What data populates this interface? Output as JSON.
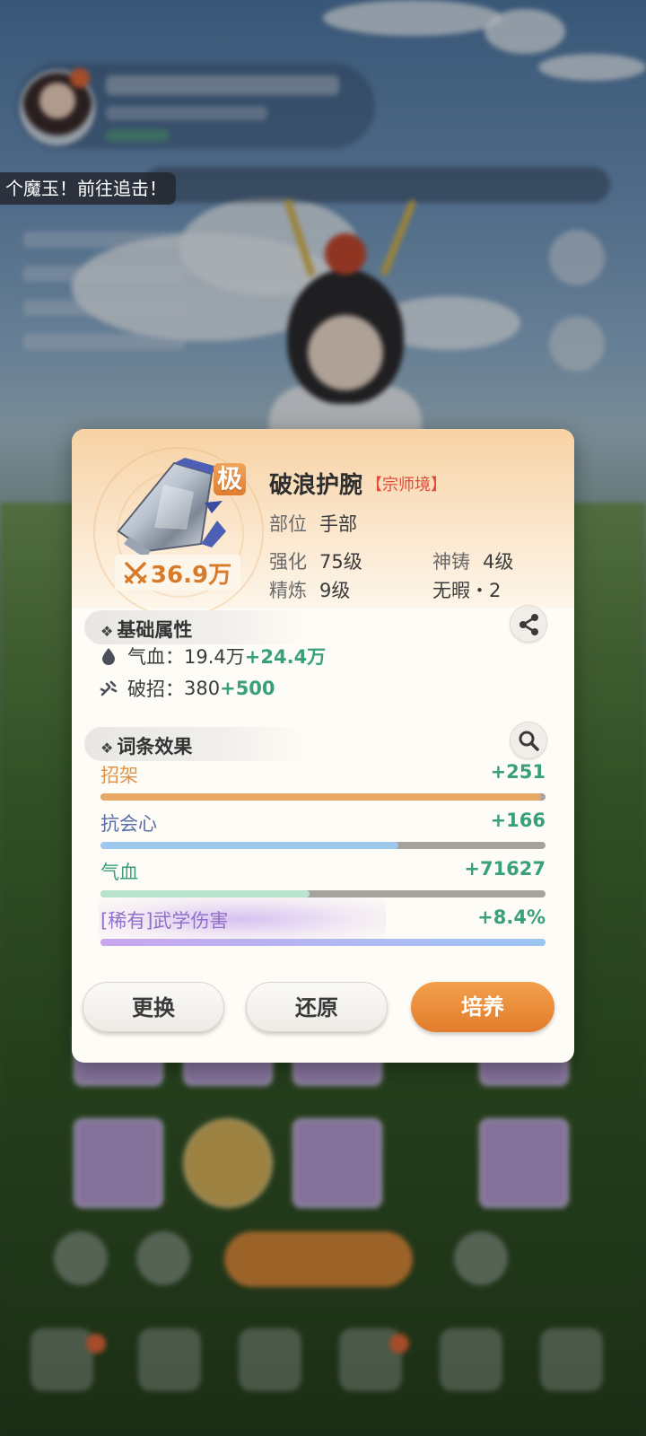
{
  "notification": {
    "text": "个魔玉！前往追击！"
  },
  "item": {
    "name": "破浪护腕",
    "realm": "【宗师境】",
    "grade": "极",
    "power": "36.9万",
    "slot_label": "部位",
    "slot_value": "手部",
    "enhance_label": "强化",
    "enhance_value": "75级",
    "divine_label": "神铸",
    "divine_value": "4级",
    "refine_label": "精炼",
    "refine_value": "9级",
    "flawless": "无暇・2"
  },
  "basic_attributes": {
    "title": "基础属性",
    "share_icon": "share-icon",
    "rows": [
      {
        "icon": "blood-drop-icon",
        "label": "气血：",
        "base": "19.4万",
        "bonus": "+24.4万"
      },
      {
        "icon": "break-move-icon",
        "label": "破招：",
        "base": "380",
        "bonus": "+500"
      }
    ]
  },
  "affixes": {
    "title": "词条效果",
    "search_icon": "magnifier-icon",
    "rows": [
      {
        "name": "招架",
        "value": "+251",
        "fill": 0.99,
        "color": "#e8a865",
        "name_color": "#e0934a"
      },
      {
        "name": "抗会心",
        "value": "+166",
        "fill": 0.67,
        "color": "#9ec8ee",
        "name_color": "#5a6fa6"
      },
      {
        "name": "气血",
        "value": "+71627",
        "fill": 0.47,
        "color": "#b9e3cf",
        "name_color": "#3aa07a"
      },
      {
        "name": "[稀有]武学伤害",
        "value": "+8.4%",
        "fill": 1.0,
        "color": "gradient-purple-blue",
        "name_color": "#8f6fc9"
      }
    ]
  },
  "buttons": {
    "replace": "更换",
    "restore": "还原",
    "cultivate": "培养"
  },
  "colors": {
    "accent_orange": "#e27c2c",
    "bonus_green": "#3aa07a",
    "realm_red": "#e04a3a"
  }
}
